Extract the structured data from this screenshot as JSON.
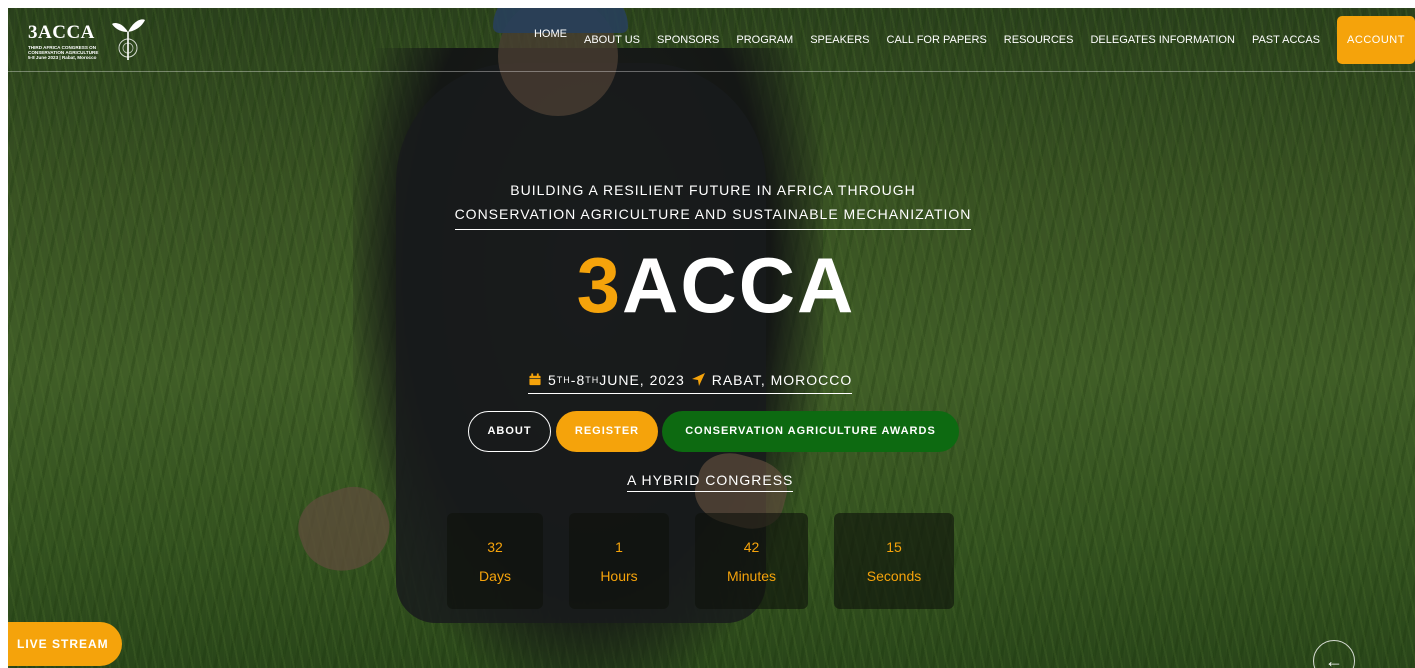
{
  "brand_colors": {
    "accent": "#f5a30b",
    "green": "#0d6a11",
    "white": "#ffffff"
  },
  "logo": {
    "title": "3ACCA",
    "subtitle_line1": "THIRD AFRICA CONGRESS ON",
    "subtitle_line2": "CONSERVATION AGRICULTURE",
    "subtitle_line3": "5-8 June 2023 | Rabat, Morocco",
    "icon": "seedling-icon"
  },
  "nav": {
    "items": [
      {
        "label": "HOME"
      },
      {
        "label": "ABOUT US"
      },
      {
        "label": "SPONSORS"
      },
      {
        "label": "PROGRAM"
      },
      {
        "label": "SPEAKERS"
      },
      {
        "label": "CALL FOR PAPERS"
      },
      {
        "label": "RESOURCES"
      },
      {
        "label": "DELEGATES INFORMATION"
      },
      {
        "label": "PAST ACCAS"
      }
    ],
    "account_label": "ACCOUNT"
  },
  "hero": {
    "tagline_line1": "BUILDING A RESILIENT FUTURE IN AFRICA THROUGH",
    "tagline_line2": "CONSERVATION AGRICULTURE AND SUSTAINABLE MECHANIZATION",
    "brand_number": "3",
    "brand_text": "ACCA",
    "date_start": "5",
    "date_start_suffix": "TH",
    "date_end": "-8",
    "date_end_suffix": "TH",
    "date_rest": " JUNE, 2023",
    "location": "RABAT, MOROCCO",
    "calendar_icon": "calendar-icon",
    "location_icon": "location-arrow-icon",
    "buttons": {
      "about": "ABOUT",
      "register": "REGISTER",
      "awards": "CONSERVATION AGRICULTURE AWARDS"
    },
    "hybrid": "A HYBRID CONGRESS"
  },
  "countdown": [
    {
      "value": "32",
      "label": "Days"
    },
    {
      "value": "1",
      "label": "Hours"
    },
    {
      "value": "42",
      "label": "Minutes"
    },
    {
      "value": "15",
      "label": "Seconds"
    }
  ],
  "live_stream": "LIVE STREAM",
  "scroll": {
    "icon": "arrow-left-icon",
    "glyph": "←"
  }
}
